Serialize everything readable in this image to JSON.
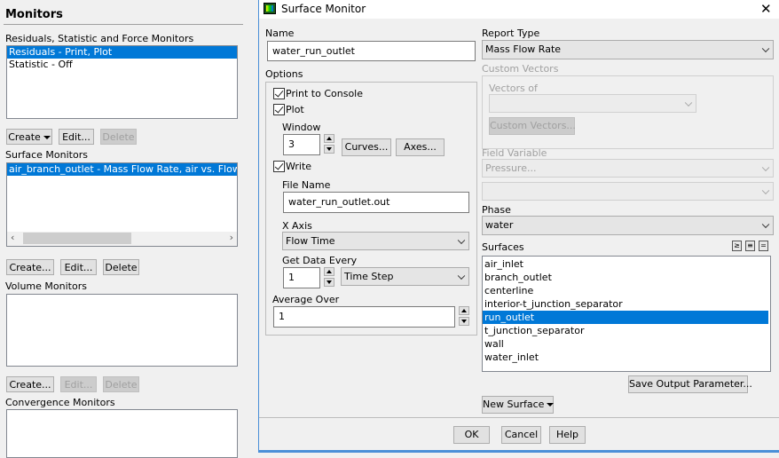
{
  "monitors_panel": {
    "title": "Monitors",
    "residuals": {
      "label": "Residuals, Statistic and Force Monitors",
      "items": [
        "Residuals - Print, Plot",
        "Statistic - Off"
      ],
      "create": "Create",
      "edit": "Edit...",
      "delete": "Delete"
    },
    "surface": {
      "label": "Surface Monitors",
      "items": [
        "air_branch_outlet - Mass Flow Rate, air vs. Flow Time"
      ],
      "create": "Create...",
      "edit": "Edit...",
      "delete": "Delete"
    },
    "volume": {
      "label": "Volume Monitors",
      "create": "Create...",
      "edit": "Edit...",
      "delete": "Delete"
    },
    "convergence": {
      "label": "Convergence Monitors"
    }
  },
  "dialog": {
    "title": "Surface Monitor",
    "name_label": "Name",
    "name_value": "water_run_outlet",
    "options_label": "Options",
    "print_to_console": {
      "label": "Print to Console",
      "checked": true
    },
    "plot": {
      "label": "Plot",
      "checked": true
    },
    "window_label": "Window",
    "window_value": "3",
    "curves": "Curves...",
    "axes": "Axes...",
    "write": {
      "label": "Write",
      "checked": true
    },
    "file_name_label": "File Name",
    "file_name_value": "water_run_outlet.out",
    "x_axis_label": "X Axis",
    "x_axis_value": "Flow Time",
    "get_data_every_label": "Get Data Every",
    "get_data_every_value": "1",
    "get_data_every_unit": "Time Step",
    "average_over_label": "Average Over",
    "average_over_value": "1",
    "report_type_label": "Report Type",
    "report_type_value": "Mass Flow Rate",
    "custom_vectors_label": "Custom Vectors",
    "vectors_of_label": "Vectors of",
    "custom_vectors_button": "Custom Vectors...",
    "field_variable_label": "Field Variable",
    "field_variable_value": "Pressure...",
    "phase_label": "Phase",
    "phase_value": "water",
    "surfaces_label": "Surfaces",
    "surfaces": [
      "air_inlet",
      "branch_outlet",
      "centerline",
      "interior-t_junction_separator",
      "run_outlet",
      "t_junction_separator",
      "wall",
      "water_inlet"
    ],
    "selected_surface": "run_outlet",
    "save_output_parameter": "Save Output Parameter...",
    "new_surface": "New Surface",
    "ok": "OK",
    "cancel": "Cancel",
    "help": "Help",
    "selection_color": "#0078d7"
  }
}
